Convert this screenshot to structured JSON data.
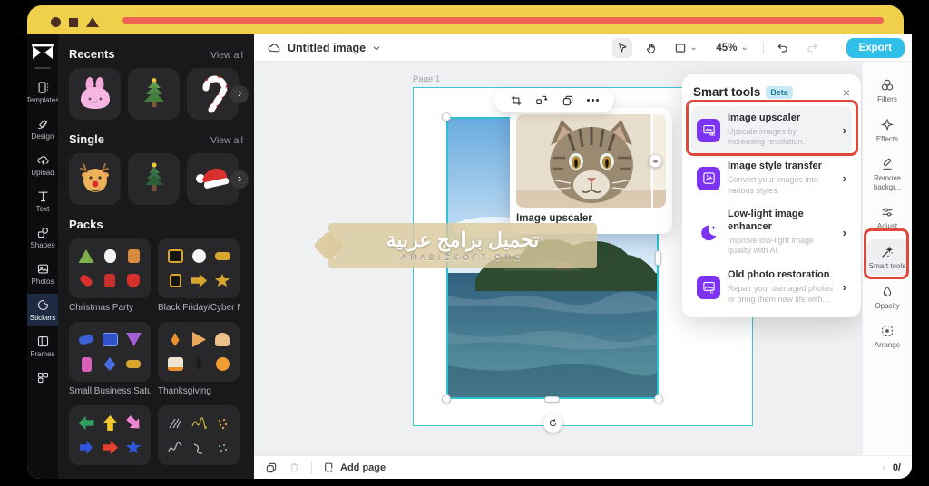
{
  "colors": {
    "chrome_yellow": "#f0d04a",
    "chrome_salmon": "#ee6353",
    "accent_cyan": "#2cc2d4",
    "export_cyan": "#2fbfe8",
    "annotation_red": "#e2473c",
    "tool_purple": "#7c33f2",
    "panel_dark": "#19191b"
  },
  "left_rail": {
    "items": [
      {
        "label": "Templates"
      },
      {
        "label": "Design"
      },
      {
        "label": "Upload"
      },
      {
        "label": "Text"
      },
      {
        "label": "Shapes"
      },
      {
        "label": "Photos"
      },
      {
        "label": "Stickers"
      },
      {
        "label": "Frames"
      }
    ],
    "selected": "Stickers"
  },
  "stickers_panel": {
    "recents": {
      "title": "Recents",
      "view_all": "View all"
    },
    "single": {
      "title": "Single",
      "view_all": "View all"
    },
    "packs": {
      "title": "Packs",
      "items": [
        {
          "name": "Christmas Party"
        },
        {
          "name": "Black Friday/Cyber M..."
        },
        {
          "name": "Small Business Saturd..."
        },
        {
          "name": "Thanksgiving"
        }
      ]
    }
  },
  "toolbar": {
    "file_name": "Untitled image",
    "zoom_level": "45%",
    "export_label": "Export"
  },
  "canvas": {
    "page_label": "Page 1"
  },
  "upscaler_card": {
    "caption": "Image upscaler"
  },
  "smart_tools": {
    "title": "Smart tools",
    "badge": "Beta",
    "items": [
      {
        "title": "Image upscaler",
        "desc": "Upscale images by increasing resolution."
      },
      {
        "title": "Image style transfer",
        "desc": "Convert your images into various styles."
      },
      {
        "title": "Low-light image enhancer",
        "desc": "Improve low-light image quality with AI."
      },
      {
        "title": "Old photo restoration",
        "desc": "Repair your damaged photos or bring them new life with..."
      }
    ]
  },
  "right_rail": {
    "items": [
      {
        "label": "Filters"
      },
      {
        "label": "Effects"
      },
      {
        "label": "Remove backgr..."
      },
      {
        "label": "Adjust"
      },
      {
        "label": "Smart tools"
      },
      {
        "label": "Opacity"
      },
      {
        "label": "Arrange"
      }
    ],
    "selected": "Smart tools"
  },
  "bottom_bar": {
    "add_page": "Add page",
    "page_indicator": "0/"
  },
  "watermark": {
    "line1": "تحميل برامج عربية",
    "line2": "ARABICSOFT.ORG"
  }
}
